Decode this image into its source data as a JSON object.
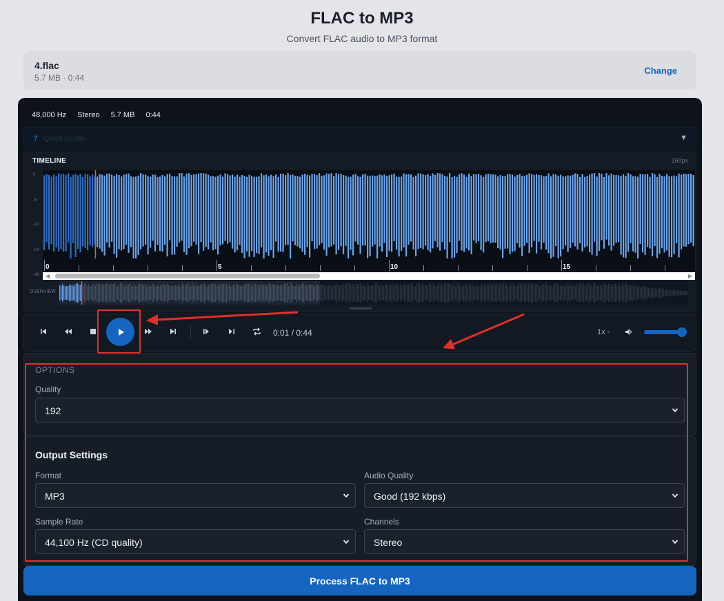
{
  "header": {
    "title": "FLAC to MP3",
    "subtitle": "Convert FLAC audio to MP3 format"
  },
  "file": {
    "name": "4.flac",
    "meta": "5.7 MB · 0:44",
    "change_label": "Change"
  },
  "info": {
    "sample_rate": "48,000 Hz",
    "channels": "Stereo",
    "size": "5.7 MB",
    "duration": "0:44"
  },
  "guide": {
    "icon": "?",
    "label": "Quick Guide",
    "caret": "▼"
  },
  "timeline": {
    "label": "TIMELINE",
    "zoom": "160px",
    "db_labels": [
      "0",
      "-6",
      "-12",
      "-24",
      "-48"
    ],
    "ruler_labels": [
      "0",
      "5",
      "10",
      "15"
    ],
    "overview_label": "OVERVIEW",
    "playhead_fraction": 0.08
  },
  "transport": {
    "time": "0:01 / 0:44",
    "speed": "1x -",
    "volume_fraction": 1.0,
    "icons": [
      "skip-start-icon",
      "rewind-icon",
      "stop-icon",
      "play-icon",
      "fast-forward-icon",
      "skip-end-icon",
      "step-back-icon",
      "step-forward-icon",
      "loop-icon",
      "volume-icon"
    ]
  },
  "options": {
    "title": "OPTIONS",
    "quality_label": "Quality",
    "quality_value": "192"
  },
  "output_settings": {
    "title": "Output Settings",
    "format_label": "Format",
    "format_value": "MP3",
    "audio_quality_label": "Audio Quality",
    "audio_quality_value": "Good (192 kbps)",
    "sample_rate_label": "Sample Rate",
    "sample_rate_value": "44,100 Hz (CD quality)",
    "channels_label": "Channels",
    "channels_value": "Stereo"
  },
  "process_button": "Process FLAC to MP3",
  "colors": {
    "accent": "#1565c0",
    "waveform_played": "#2f6fc4",
    "waveform": "#6aa4ec",
    "annotation": "#e0302a",
    "panel_bg": "#0e131b"
  }
}
